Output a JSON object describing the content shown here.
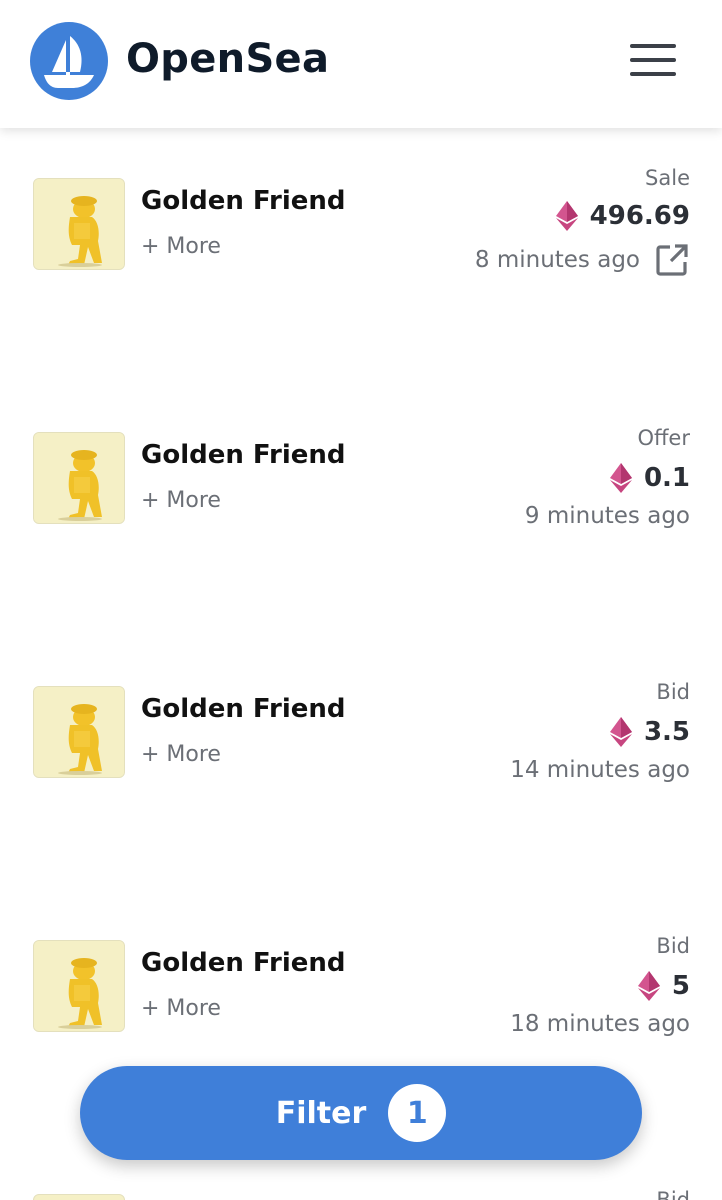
{
  "header": {
    "brand": "OpenSea",
    "logo_icon": "opensea-ship-icon",
    "menu_icon": "hamburger-menu-icon",
    "accent_color": "#3f80d8"
  },
  "events": [
    {
      "item_name": "Golden Friend",
      "more": "+ More",
      "type": "Sale",
      "price": "496.69",
      "time": "8 minutes ago",
      "has_link": true
    },
    {
      "item_name": "Golden Friend",
      "more": "+ More",
      "type": "Offer",
      "price": "0.1",
      "time": "9 minutes ago",
      "has_link": false
    },
    {
      "item_name": "Golden Friend",
      "more": "+ More",
      "type": "Bid",
      "price": "3.5",
      "time": "14 minutes ago",
      "has_link": false
    },
    {
      "item_name": "Golden Friend",
      "more": "+ More",
      "type": "Bid",
      "price": "5",
      "time": "18 minutes ago",
      "has_link": false
    },
    {
      "type": "Bid"
    }
  ],
  "filter": {
    "label": "Filter",
    "count": "1"
  }
}
